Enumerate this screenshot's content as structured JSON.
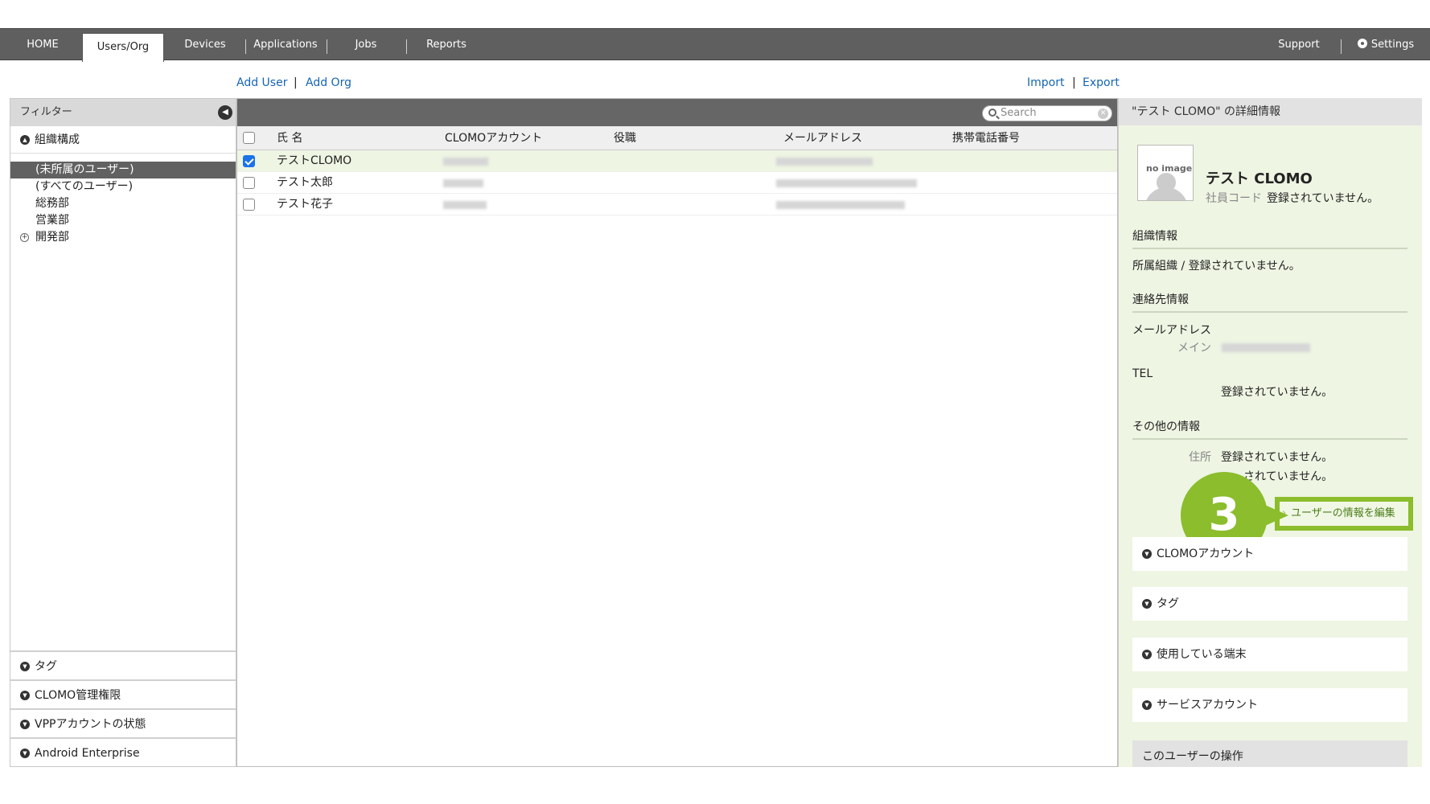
{
  "nav": {
    "items": [
      {
        "label": "HOME"
      },
      {
        "label": "Users/Org"
      },
      {
        "label": "Devices"
      },
      {
        "label": "Applications"
      },
      {
        "label": "Jobs"
      },
      {
        "label": "Reports"
      }
    ],
    "support": "Support",
    "settings": "Settings"
  },
  "actions": {
    "add_user": "Add User",
    "sep": "|",
    "add_org": "Add Org",
    "import": "Import",
    "export": "Export"
  },
  "filter": {
    "title": "フィルター",
    "org_section": "組織構成",
    "tree": [
      {
        "label": "(未所属のユーザー)"
      },
      {
        "label": "(すべてのユーザー)"
      },
      {
        "label": "総務部"
      },
      {
        "label": "営業部"
      },
      {
        "label": "開発部"
      }
    ],
    "bottom": [
      {
        "label": "タグ"
      },
      {
        "label": "CLOMO管理権限"
      },
      {
        "label": "VPPアカウントの状態"
      },
      {
        "label": "Android Enterprise"
      }
    ]
  },
  "list": {
    "search_placeholder": "Search",
    "columns": [
      "氏 名",
      "CLOMOアカウント",
      "役職",
      "メールアドレス",
      "携帯電話番号"
    ],
    "rows": [
      {
        "name": "テストCLOMO",
        "checked": true
      },
      {
        "name": "テスト太郎",
        "checked": false
      },
      {
        "name": "テスト花子",
        "checked": false
      }
    ]
  },
  "detail": {
    "title": "\"テスト CLOMO\" の詳細情報",
    "no_image": "no image",
    "user_name": "テスト CLOMO",
    "code_label": "社員コード",
    "code_value": "登録されていません。",
    "org_section": "組織情報",
    "org_value": "所属組織 / 登録されていません。",
    "contact_section": "連絡先情報",
    "email_label": "メールアドレス",
    "email_main": "メイン",
    "tel_label": "TEL",
    "tel_value": "登録されていません。",
    "other_section": "その他の情報",
    "address_label": "住所",
    "address_value": "登録されていません。",
    "url_value": "されていません。",
    "edit_button": "ユーザーの情報を編集",
    "step": "3",
    "accordions": [
      {
        "label": "CLOMOアカウント"
      },
      {
        "label": "タグ"
      },
      {
        "label": "使用している端末"
      },
      {
        "label": "サービスアカウント"
      }
    ],
    "operations": "このユーザーの操作"
  },
  "colors": {
    "nav_bg": "#5f5f5f",
    "link": "#1565b5",
    "accent_green": "#8bbd2c",
    "detail_bg": "#eef5e3"
  }
}
